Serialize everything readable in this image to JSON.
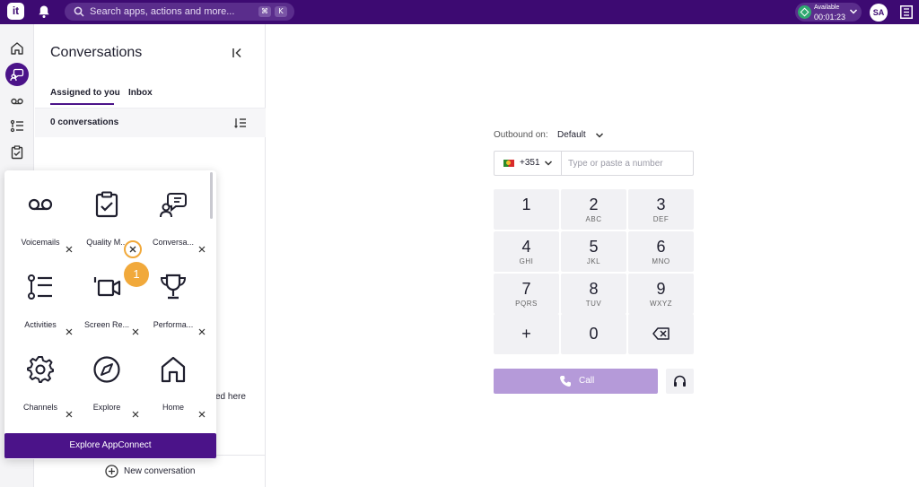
{
  "topbar": {
    "logo_text": "it",
    "search_placeholder": "Search apps, actions and more...",
    "shortcut_keys": [
      "⌘",
      "K"
    ],
    "status_label": "Available",
    "status_timer": "00:01:23",
    "avatar_initials": "SA",
    "colors": {
      "brand": "#3d0a72",
      "status": "#2fa870"
    },
    "icons": [
      "bell-icon",
      "search-icon",
      "chevron-down-icon",
      "side-panel-icon"
    ]
  },
  "rail": {
    "items": [
      {
        "icon": "home-icon"
      },
      {
        "icon": "conversations-icon",
        "active": true
      },
      {
        "icon": "voicemail-icon"
      },
      {
        "icon": "activities-icon"
      },
      {
        "icon": "quality-icon"
      }
    ]
  },
  "conversations": {
    "title": "Conversations",
    "tabs": [
      {
        "label": "Assigned to you",
        "active": true
      },
      {
        "label": "Inbox",
        "active": false
      }
    ],
    "count_label": "0 conversations",
    "partial_text": "ed here",
    "new_conversation_label": "New conversation"
  },
  "apps_popover": {
    "items": [
      {
        "label": "Voicemails",
        "icon": "voicemail-icon"
      },
      {
        "label": "Quality M...",
        "icon": "quality-clipboard-icon"
      },
      {
        "label": "Conversa...",
        "icon": "conversations-icon"
      },
      {
        "label": "Activities",
        "icon": "activities-list-icon"
      },
      {
        "label": "Screen Re...",
        "icon": "screen-recording-icon"
      },
      {
        "label": "Performa...",
        "icon": "trophy-icon"
      },
      {
        "label": "Channels",
        "icon": "gear-icon"
      },
      {
        "label": "Explore",
        "icon": "compass-icon"
      },
      {
        "label": "Home",
        "icon": "home-icon"
      }
    ],
    "step_badge": "1",
    "explore_button_label": "Explore AppConnect",
    "highlight_color": "#f1a93b"
  },
  "dialer": {
    "outbound_label": "Outbound on:",
    "outbound_value": "Default",
    "country_code": "+351",
    "phone_placeholder": "Type or paste a number",
    "keys": [
      {
        "digit": "1",
        "letters": ""
      },
      {
        "digit": "2",
        "letters": "ABC"
      },
      {
        "digit": "3",
        "letters": "DEF"
      },
      {
        "digit": "4",
        "letters": "GHI"
      },
      {
        "digit": "5",
        "letters": "JKL"
      },
      {
        "digit": "6",
        "letters": "MNO"
      },
      {
        "digit": "7",
        "letters": "PQRS"
      },
      {
        "digit": "8",
        "letters": "TUV"
      },
      {
        "digit": "9",
        "letters": "WXYZ"
      },
      {
        "digit": "+",
        "letters": ""
      },
      {
        "digit": "0",
        "letters": ""
      },
      {
        "digit": "",
        "letters": "",
        "icon": "backspace-icon"
      }
    ],
    "call_label": "Call",
    "call_color": "#b59ad9"
  }
}
